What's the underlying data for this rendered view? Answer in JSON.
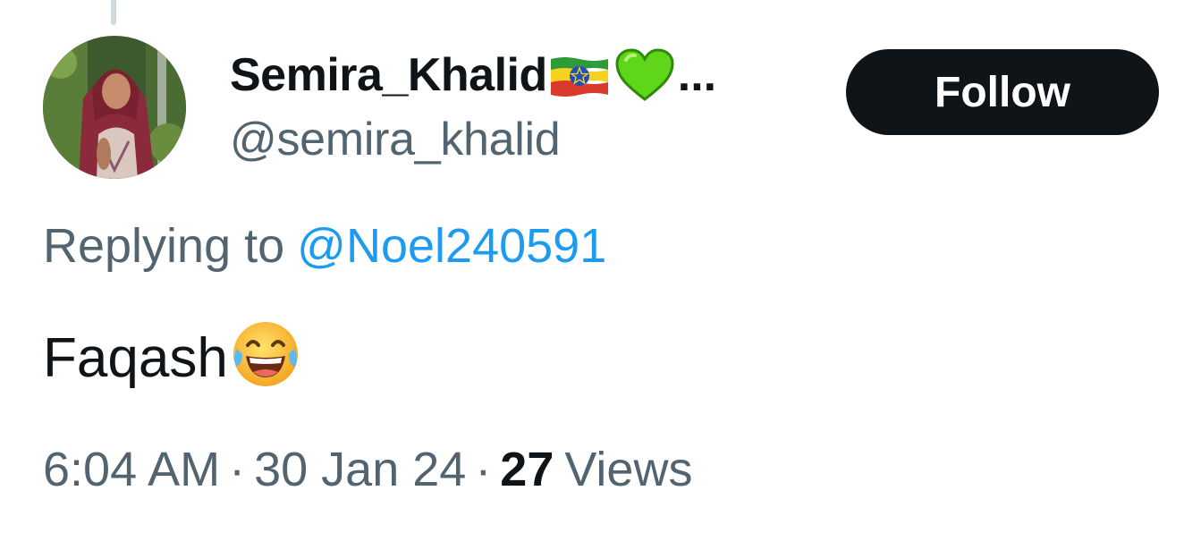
{
  "tweet": {
    "author": {
      "display_name": "Semira_Khalid",
      "name_icons": [
        "ethiopia-flag-icon",
        "green-heart-icon"
      ],
      "name_truncation": "...",
      "handle": "@semira_khalid",
      "avatar": "avatar-photo"
    },
    "follow_label": "Follow",
    "replying_prefix": "Replying to",
    "replying_to": "@Noel240591",
    "text": "Faqash",
    "text_emoji": "face-with-tears-of-joy-icon",
    "time": "6:04 AM",
    "separator": "·",
    "date": "30 Jan 24",
    "views_count": "27",
    "views_label": "Views"
  },
  "colors": {
    "text_primary": "#0f1419",
    "text_secondary": "#536471",
    "link": "#1d9bf0",
    "button_bg": "#0f1419",
    "button_text": "#ffffff"
  }
}
